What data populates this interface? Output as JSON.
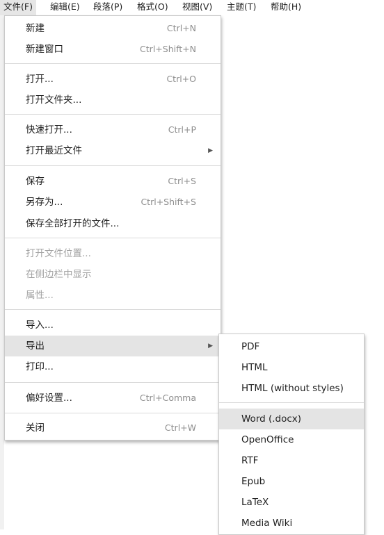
{
  "menubar": {
    "items": [
      {
        "label": "文件(F)"
      },
      {
        "label": "编辑(E)"
      },
      {
        "label": "段落(P)"
      },
      {
        "label": "格式(O)"
      },
      {
        "label": "视图(V)"
      },
      {
        "label": "主题(T)"
      },
      {
        "label": "帮助(H)"
      }
    ]
  },
  "file_menu": {
    "new": {
      "label": "新建",
      "shortcut": "Ctrl+N"
    },
    "new_window": {
      "label": "新建窗口",
      "shortcut": "Ctrl+Shift+N"
    },
    "open": {
      "label": "打开...",
      "shortcut": "Ctrl+O"
    },
    "open_folder": {
      "label": "打开文件夹..."
    },
    "quick_open": {
      "label": "快速打开...",
      "shortcut": "Ctrl+P"
    },
    "open_recent": {
      "label": "打开最近文件"
    },
    "save": {
      "label": "保存",
      "shortcut": "Ctrl+S"
    },
    "save_as": {
      "label": "另存为...",
      "shortcut": "Ctrl+Shift+S"
    },
    "save_all": {
      "label": "保存全部打开的文件..."
    },
    "open_location": {
      "label": "打开文件位置..."
    },
    "show_in_sidebar": {
      "label": "在侧边栏中显示"
    },
    "properties": {
      "label": "属性..."
    },
    "import": {
      "label": "导入..."
    },
    "export": {
      "label": "导出"
    },
    "print": {
      "label": "打印..."
    },
    "preferences": {
      "label": "偏好设置...",
      "shortcut": "Ctrl+Comma"
    },
    "close": {
      "label": "关闭",
      "shortcut": "Ctrl+W"
    }
  },
  "export_menu": {
    "items": [
      {
        "label": "PDF"
      },
      {
        "label": "HTML"
      },
      {
        "label": "HTML (without styles)"
      },
      {
        "label": "Word (.docx)"
      },
      {
        "label": "OpenOffice"
      },
      {
        "label": "RTF"
      },
      {
        "label": "Epub"
      },
      {
        "label": "LaTeX"
      },
      {
        "label": "Media Wiki"
      }
    ],
    "hovered": "Word (.docx)"
  },
  "icons": {
    "submenu_arrow": "chevron-right-icon"
  }
}
